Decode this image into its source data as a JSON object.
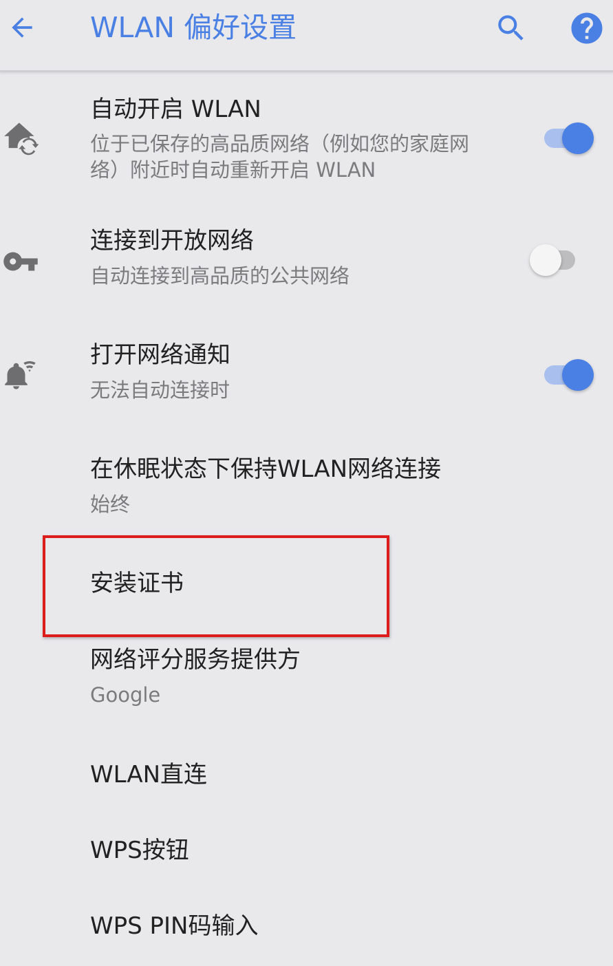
{
  "appbar": {
    "title": "WLAN 偏好设置",
    "back_icon": "arrow-back-icon",
    "search_icon": "search-icon",
    "help_icon": "help-icon",
    "accent_color": "#4a80e3"
  },
  "settings": {
    "auto_wlan": {
      "title": "自动开启 WLAN",
      "summary": "位于已保存的高品质网络（例如您的家庭网络）附近时自动重新开启 WLAN",
      "icon": "home-sync-icon",
      "enabled": true
    },
    "open_network": {
      "title": "连接到开放网络",
      "summary": "自动连接到高品质的公共网络",
      "icon": "key-icon",
      "enabled": false
    },
    "network_notify": {
      "title": "打开网络通知",
      "summary": "无法自动连接时",
      "icon": "notification-wifi-icon",
      "enabled": true
    },
    "keep_wlan_sleep": {
      "title": "在休眠状态下保持WLAN网络连接",
      "summary": "始终"
    },
    "install_cert": {
      "title": "安装证书"
    },
    "score_provider": {
      "title": "网络评分服务提供方",
      "summary": "Google"
    },
    "wlan_direct": {
      "title": "WLAN直连"
    },
    "wps_button": {
      "title": "WPS按钮"
    },
    "wps_pin": {
      "title": "WPS PIN码输入"
    }
  },
  "highlight_color": "#dd1c1c"
}
